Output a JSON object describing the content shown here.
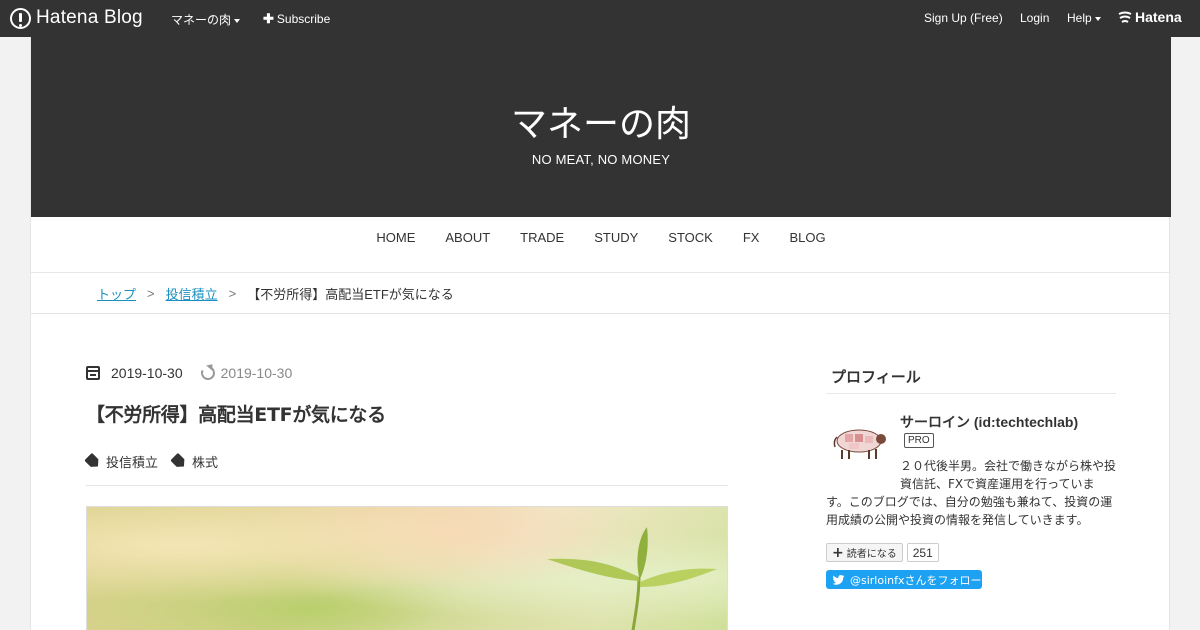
{
  "topbar": {
    "logo_text": "Hatena Blog",
    "blog_menu": "マネーの肉",
    "subscribe": "Subscribe",
    "signup": "Sign Up (Free)",
    "login": "Login",
    "help": "Help",
    "brand": "Hatena"
  },
  "header": {
    "title": "マネーの肉",
    "description": "NO MEAT, NO MONEY"
  },
  "nav": {
    "items": [
      "HOME",
      "ABOUT",
      "TRADE",
      "STUDY",
      "STOCK",
      "FX",
      "BLOG"
    ]
  },
  "breadcrumb": {
    "top": "トップ",
    "category": "投信積立",
    "sep": ">",
    "current": "【不労所得】高配当ETFが気になる"
  },
  "article": {
    "date_published": "2019-10-30",
    "date_updated": "2019-10-30",
    "title": "【不労所得】高配当ETFが気になる",
    "categories": [
      "投信積立",
      "株式"
    ]
  },
  "sidebar": {
    "profile_title": "プロフィール",
    "name": "サーロイン (id:techtechlab)",
    "badge": "PRO",
    "description": "２０代後半男。会社で働きながら株や投資信託、FXで資産運用を行っています。このブログでは、自分の勉強も兼ねて、投資の運用成績の公開や投資の情報を発信していきます。",
    "reader_button": "読者になる",
    "reader_count": "251",
    "twitter_follow": "@sirloinfxさんをフォロー"
  },
  "colors": {
    "topbar_bg": "#333333",
    "header_bg": "#333333",
    "link": "#1a8fc0",
    "twitter": "#1da1f2"
  }
}
